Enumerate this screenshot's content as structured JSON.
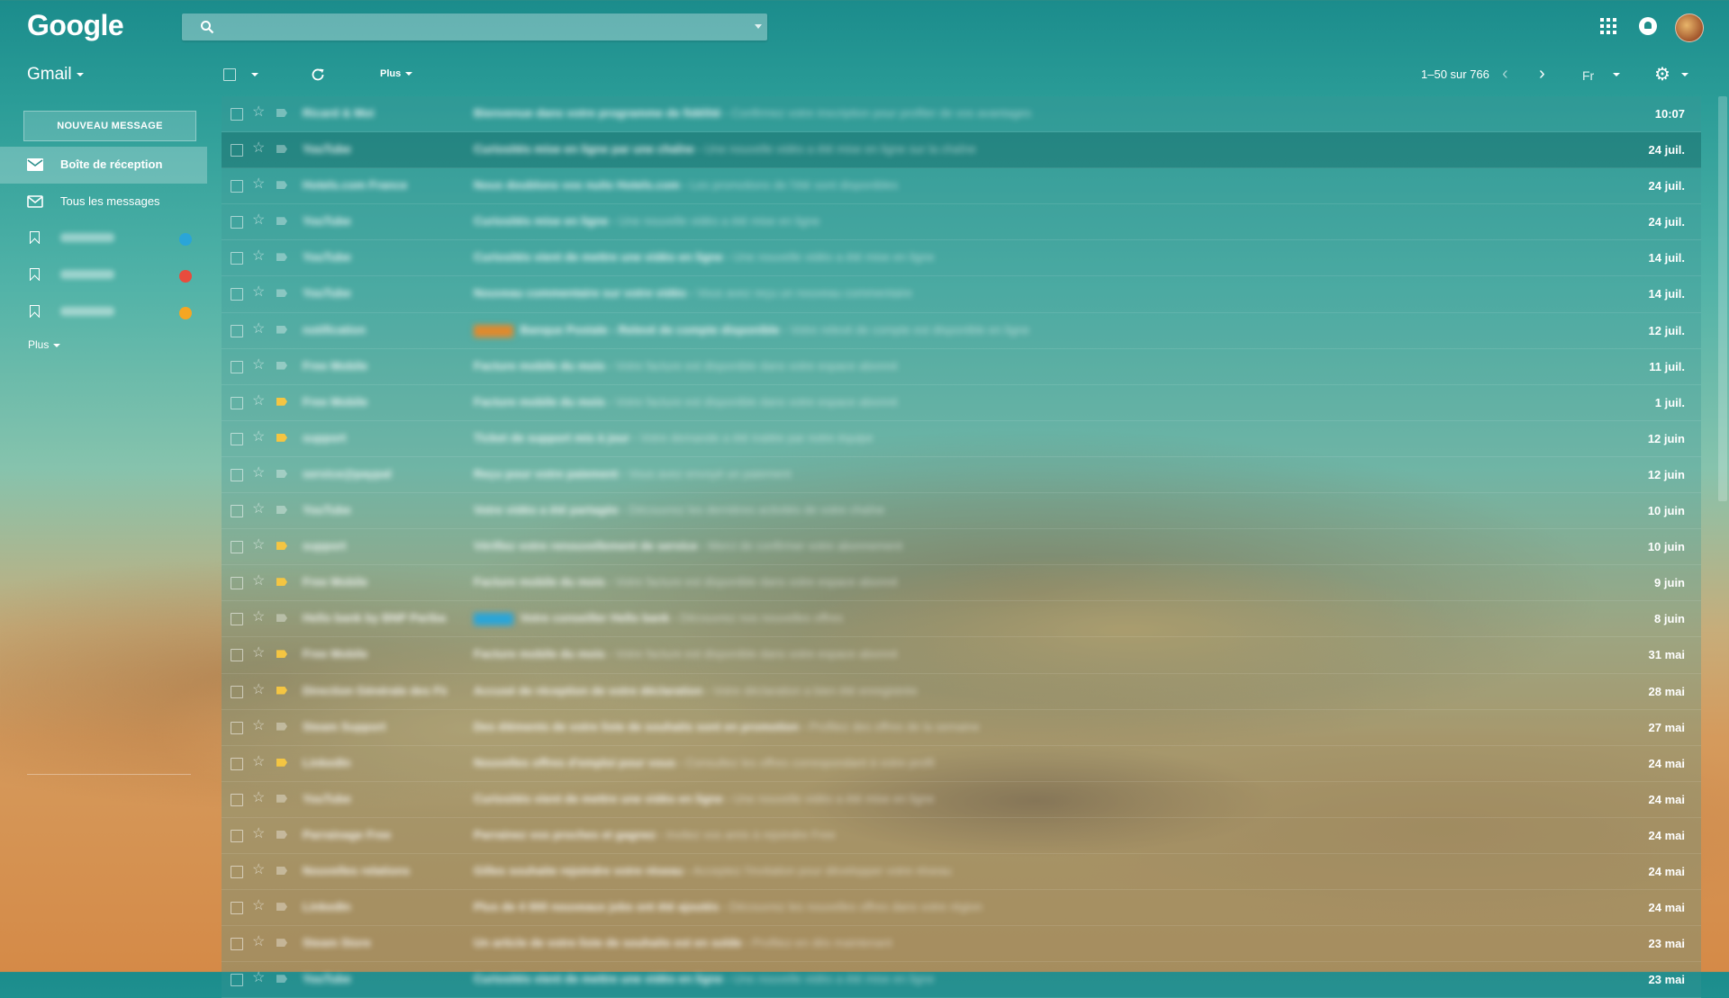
{
  "header": {
    "logo": "Google",
    "search": {
      "value": "",
      "placeholder": ""
    }
  },
  "toolbar": {
    "app_label": "Gmail",
    "more_label": "Plus",
    "pagination": "1–50 sur 766",
    "lang_label": "Fr"
  },
  "sidebar": {
    "compose_label": "NOUVEAU MESSAGE",
    "items": [
      {
        "label": "Boîte de réception",
        "active": true,
        "icon": "inbox-icon"
      },
      {
        "label": "Tous les messages",
        "active": false,
        "icon": "mail-icon"
      },
      {
        "label": "",
        "active": false,
        "icon": "label-icon",
        "dot_color": "#2aa5d8"
      },
      {
        "label": "",
        "active": false,
        "icon": "label-icon",
        "dot_color": "#e84c3d"
      },
      {
        "label": "",
        "active": false,
        "icon": "label-icon",
        "dot_color": "#f5a623"
      }
    ],
    "more_label": "Plus"
  },
  "colors": {
    "accent_teal": "#1b8c8c",
    "label_blue": "#2aa5d8",
    "label_red": "#e84c3d",
    "label_orange": "#f5a623",
    "important_yellow": "#f4c542"
  },
  "emails": [
    {
      "sender": "Ricard & Moi",
      "subject": "Bienvenue dans votre programme de fidélité",
      "snippet": "Confirmez votre inscription pour profiter de vos avantages",
      "date": "10:07",
      "important": false,
      "highlight": false
    },
    {
      "sender": "YouTube",
      "subject": "Curiosités mise en ligne par une chaîne",
      "snippet": "Une nouvelle vidéo a été mise en ligne sur la chaîne",
      "date": "24 juil.",
      "important": false,
      "highlight": true
    },
    {
      "sender": "Hotels.com France",
      "subject": "Nous doublons vos nuits Hotels.com",
      "snippet": "Les promotions de l'été sont disponibles",
      "date": "24 juil.",
      "important": false,
      "highlight": false
    },
    {
      "sender": "YouTube",
      "subject": "Curiosités mise en ligne",
      "snippet": "Une nouvelle vidéo a été mise en ligne",
      "date": "24 juil.",
      "important": false,
      "highlight": false
    },
    {
      "sender": "YouTube",
      "subject": "Curiosités vient de mettre une vidéo en ligne",
      "snippet": "Une nouvelle vidéo a été mise en ligne",
      "date": "14 juil.",
      "important": false,
      "highlight": false
    },
    {
      "sender": "YouTube",
      "subject": "Nouveau commentaire sur votre vidéo",
      "snippet": "Vous avez reçu un nouveau commentaire",
      "date": "14 juil.",
      "important": false,
      "highlight": false
    },
    {
      "sender": "notification",
      "subject": "Banque Postale - Relevé de compte disponible",
      "snippet": "Votre relevé de compte est disponible en ligne",
      "date": "12 juil.",
      "important": false,
      "highlight": false,
      "tag": "orange"
    },
    {
      "sender": "Free Mobile",
      "subject": "Facture mobile du mois",
      "snippet": "Votre facture est disponible dans votre espace abonné",
      "date": "11 juil.",
      "important": false,
      "highlight": false
    },
    {
      "sender": "Free Mobile",
      "subject": "Facture mobile du mois",
      "snippet": "Votre facture est disponible dans votre espace abonné",
      "date": "1 juil.",
      "important": true,
      "highlight": false
    },
    {
      "sender": "support",
      "subject": "Ticket de support mis à jour",
      "snippet": "Votre demande a été traitée par notre équipe",
      "date": "12 juin",
      "important": true,
      "highlight": false
    },
    {
      "sender": "service@paypal",
      "subject": "Reçu pour votre paiement",
      "snippet": "Vous avez envoyé un paiement",
      "date": "12 juin",
      "important": false,
      "highlight": false
    },
    {
      "sender": "YouTube",
      "subject": "Votre vidéo a été partagée",
      "snippet": "Découvrez les dernières activités de votre chaîne",
      "date": "10 juin",
      "important": false,
      "highlight": false
    },
    {
      "sender": "support",
      "subject": "Vérifiez votre renouvellement de service",
      "snippet": "Merci de confirmer votre abonnement",
      "date": "10 juin",
      "important": true,
      "highlight": false
    },
    {
      "sender": "Free Mobile",
      "subject": "Facture mobile du mois",
      "snippet": "Votre facture est disponible dans votre espace abonné",
      "date": "9 juin",
      "important": true,
      "highlight": false
    },
    {
      "sender": "Hello bank by BNP Paribas",
      "subject": "Votre conseiller Hello bank",
      "snippet": "Découvrez nos nouvelles offres",
      "date": "8 juin",
      "important": false,
      "highlight": false,
      "tag": "blue"
    },
    {
      "sender": "Free Mobile",
      "subject": "Facture mobile du mois",
      "snippet": "Votre facture est disponible dans votre espace abonné",
      "date": "31 mai",
      "important": true,
      "highlight": false
    },
    {
      "sender": "Direction Générale des Finances",
      "subject": "Accusé de réception de votre déclaration",
      "snippet": "Votre déclaration a bien été enregistrée",
      "date": "28 mai",
      "important": true,
      "highlight": false
    },
    {
      "sender": "Steam Support",
      "subject": "Des éléments de votre liste de souhaits sont en promotion",
      "snippet": "Profitez des offres de la semaine",
      "date": "27 mai",
      "important": false,
      "highlight": false
    },
    {
      "sender": "LinkedIn",
      "subject": "Nouvelles offres d'emploi pour vous",
      "snippet": "Consultez les offres correspondant à votre profil",
      "date": "24 mai",
      "important": true,
      "highlight": false
    },
    {
      "sender": "YouTube",
      "subject": "Curiosités vient de mettre une vidéo en ligne",
      "snippet": "Une nouvelle vidéo a été mise en ligne",
      "date": "24 mai",
      "important": false,
      "highlight": false
    },
    {
      "sender": "Parrainage Free",
      "subject": "Parrainez vos proches et gagnez",
      "snippet": "Invitez vos amis à rejoindre Free",
      "date": "24 mai",
      "important": false,
      "highlight": false
    },
    {
      "sender": "Nouvelles relations",
      "subject": "Gilles souhaite rejoindre votre réseau",
      "snippet": "Acceptez l'invitation pour développer votre réseau",
      "date": "24 mai",
      "important": false,
      "highlight": false
    },
    {
      "sender": "LinkedIn",
      "subject": "Plus de 4 000 nouveaux jobs ont été ajoutés",
      "snippet": "Découvrez les nouvelles offres dans votre région",
      "date": "24 mai",
      "important": false,
      "highlight": false
    },
    {
      "sender": "Steam Store",
      "subject": "Un article de votre liste de souhaits est en solde",
      "snippet": "Profitez-en dès maintenant",
      "date": "23 mai",
      "important": false,
      "highlight": false
    },
    {
      "sender": "YouTube",
      "subject": "Curiosités vient de mettre une vidéo en ligne",
      "snippet": "Une nouvelle vidéo a été mise en ligne",
      "date": "23 mai",
      "important": false,
      "highlight": false
    }
  ]
}
